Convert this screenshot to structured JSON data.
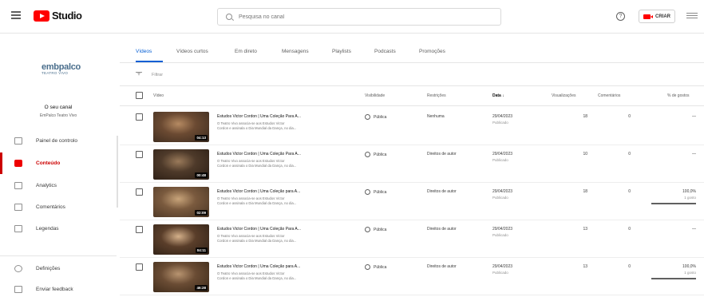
{
  "header": {
    "logo_text": "Studio",
    "search_placeholder": "Pesquisa no canal",
    "help_glyph": "?",
    "create_label": "CRIAR"
  },
  "sidebar": {
    "channel_logo_main": "embpalco",
    "channel_logo_sub": "TEATRO VIVO",
    "channel_title": "O seu canal",
    "channel_name": "EmPalco Teatro Vivo",
    "items": [
      {
        "label": "Painel de controlo",
        "icon": "dashboard-icon"
      },
      {
        "label": "Conteúdo",
        "icon": "content-icon",
        "active": true
      },
      {
        "label": "Analytics",
        "icon": "analytics-icon"
      },
      {
        "label": "Comentários",
        "icon": "comments-icon"
      },
      {
        "label": "Legendas",
        "icon": "subtitles-icon"
      }
    ],
    "bottom_items": [
      {
        "label": "Definições",
        "icon": "settings-icon"
      },
      {
        "label": "Enviar feedback",
        "icon": "feedback-icon"
      }
    ]
  },
  "tabs": [
    "Vídeos",
    "Vídeos curtos",
    "Em direto",
    "Mensagens",
    "Playlists",
    "Podcasts",
    "Promoções"
  ],
  "filter_label": "Filtrar",
  "columns": {
    "video": "Vídeo",
    "visibility": "Visibilidade",
    "restrictions": "Restrições",
    "date": "Data ↓",
    "views": "Visualizações",
    "comments": "Comentários",
    "likes": "% de gostos"
  },
  "rows": [
    {
      "title": "Estudos Victor Cordon | Uma Coleção Para A...",
      "desc1": "O Teatro Vivo associa-se aos Estudos Victor",
      "desc2": "Cordon e assinala o Dia Mundial da Dança, no dia...",
      "duration": "04:13",
      "visibility": "Pública",
      "restrictions": "Nenhuma",
      "date": "29/04/2023",
      "status": "Publicado",
      "views": "18",
      "comments": "0",
      "likes": "—",
      "likes_sub": "",
      "thumb_colors": [
        "#6b4a32",
        "#b58a62",
        "#3a2a1e"
      ]
    },
    {
      "title": "Estudos Victor Cordon | Uma Coleção Para A...",
      "desc1": "O Teatro Vivo associa-se aos Estudos Victor",
      "desc2": "Cordon e assinala o Dia Mundial da Dança, no dia...",
      "duration": "00:48",
      "visibility": "Pública",
      "restrictions": "Direitos de autor",
      "date": "29/04/2023",
      "status": "Publicado",
      "views": "10",
      "comments": "0",
      "likes": "—",
      "likes_sub": "",
      "thumb_colors": [
        "#4e3a2a",
        "#9a7a5a",
        "#2a1d14"
      ]
    },
    {
      "title": "Estudos Victor Cordon | Uma Coleção para A...",
      "desc1": "O Teatro Vivo associa-se aos Estudos Victor",
      "desc2": "Cordon e assinala o Dia Mundial da Dança, no dia...",
      "duration": "02:09",
      "visibility": "Pública",
      "restrictions": "Direitos de autor",
      "date": "29/04/2023",
      "status": "Publicado",
      "views": "18",
      "comments": "0",
      "likes": "100,0%",
      "likes_sub": "1 gosto",
      "thumb_colors": [
        "#7a5a3e",
        "#c8a47a",
        "#4a3524"
      ]
    },
    {
      "title": "Estudos Victor Cordon | Uma Coleção Para A...",
      "desc1": "O Teatro Vivo associa-se aos Estudos Victor",
      "desc2": "Cordon e assinala o Dia Mundial da Dança, no dia...",
      "duration": "04:11",
      "visibility": "Pública",
      "restrictions": "Direitos de autor",
      "date": "29/04/2023",
      "status": "Publicado",
      "views": "13",
      "comments": "0",
      "likes": "—",
      "likes_sub": "",
      "thumb_colors": [
        "#5a3e2a",
        "#d4b08a",
        "#2e2016"
      ]
    },
    {
      "title": "Estudos Victor Cordon | Uma Coleção para A...",
      "desc1": "O Teatro Vivo associa-se aos Estudos Victor",
      "desc2": "Cordon e assinala o Dia Mundial da Dança, no dia...",
      "duration": "46:28",
      "visibility": "Pública",
      "restrictions": "Direitos de autor",
      "date": "29/04/2023",
      "status": "Publicado",
      "views": "13",
      "comments": "0",
      "likes": "100,0%",
      "likes_sub": "1 gosto",
      "thumb_colors": [
        "#6a4c34",
        "#b89470",
        "#3a2818"
      ]
    }
  ],
  "colors": {
    "brand_red": "#ff0000",
    "active_red": "#cc0000",
    "link_blue": "#065fd4"
  }
}
